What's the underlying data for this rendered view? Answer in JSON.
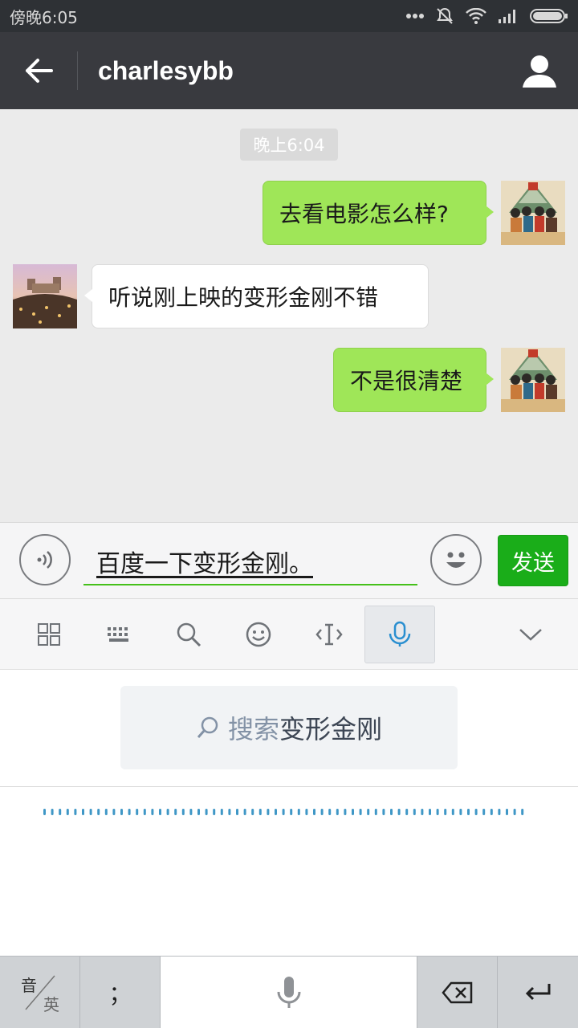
{
  "status_bar": {
    "time": "傍晚6:05"
  },
  "header": {
    "title": "charlesybb"
  },
  "chat": {
    "timestamp": "晚上6:04",
    "messages": [
      {
        "direction": "out",
        "text": "去看电影怎么样?"
      },
      {
        "direction": "in",
        "text": "听说刚上映的变形金刚不错"
      },
      {
        "direction": "out",
        "text": "不是很清楚"
      }
    ]
  },
  "input": {
    "value": "百度一下变形金刚。",
    "send_label": "发送"
  },
  "ime": {
    "tools": [
      "apps-icon",
      "keyboard-icon",
      "search-icon",
      "emoji-icon",
      "cursor-icon",
      "microphone-icon",
      "collapse-icon"
    ],
    "suggestion_prefix": "搜索",
    "suggestion_term": "变形金刚"
  },
  "keyboard": {
    "lang_top": "音",
    "lang_bottom": "英",
    "punct": "；"
  },
  "colors": {
    "accent_green": "#1aad19",
    "bubble_green": "#9fe658",
    "header_bg": "#393a3f"
  }
}
